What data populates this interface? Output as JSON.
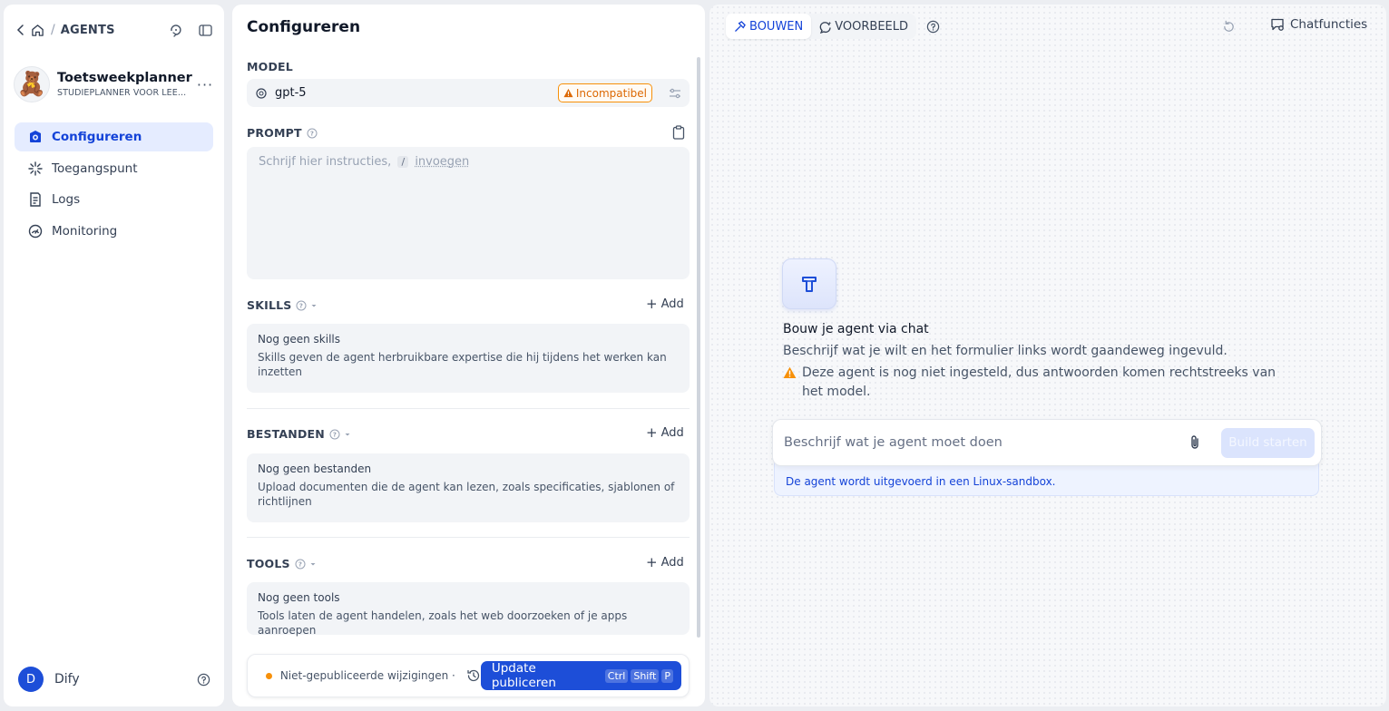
{
  "sidebar": {
    "breadcrumb": "AGENTS",
    "agent": {
      "name": "Toetsweekplanner",
      "subtitle": "STUDIEPLANNER VOOR LEE...",
      "more": "···"
    },
    "nav": [
      {
        "label": "Configureren",
        "icon": "configure-icon",
        "active": true
      },
      {
        "label": "Toegangspunt",
        "icon": "access-point-icon",
        "active": false
      },
      {
        "label": "Logs",
        "icon": "logs-icon",
        "active": false
      },
      {
        "label": "Monitoring",
        "icon": "monitoring-icon",
        "active": false
      }
    ],
    "user": {
      "initial": "D",
      "name": "Dify"
    }
  },
  "config": {
    "title": "Configureren",
    "model": {
      "label": "MODEL",
      "name": "gpt-5",
      "badge": "Incompatibel"
    },
    "prompt": {
      "label": "PROMPT",
      "placeholder_prefix": "Schrijf hier instructies,",
      "placeholder_key": "/",
      "placeholder_link": "invoegen"
    },
    "skills": {
      "label": "SKILLS",
      "add": "Add",
      "empty_title": "Nog geen skills",
      "empty_desc": "Skills geven de agent herbruikbare expertise die hij tijdens het werken kan inzetten"
    },
    "files": {
      "label": "BESTANDEN",
      "add": "Add",
      "empty_title": "Nog geen bestanden",
      "empty_desc": "Upload documenten die de agent kan lezen, zoals specificaties, sjablonen of richtlijnen"
    },
    "tools": {
      "label": "TOOLS",
      "add": "Add",
      "empty_title": "Nog geen tools",
      "empty_desc": "Tools laten de agent handelen, zoals het web doorzoeken of je apps aanroepen"
    },
    "publish": {
      "status": "Niet-gepubliceerde wijzigingen ·",
      "button": "Update publiceren",
      "keys": [
        "Ctrl",
        "Shift",
        "P"
      ]
    }
  },
  "builder": {
    "tabs": [
      {
        "label": "BOUWEN",
        "active": true
      },
      {
        "label": "VOORBEELD",
        "active": false
      }
    ],
    "chat_functions": "Chatfuncties",
    "hero": {
      "title": "Bouw je agent via chat",
      "description": "Beschrijf wat je wilt en het formulier links wordt gaandeweg ingevuld.",
      "warning": "Deze agent is nog niet ingesteld, dus antwoorden komen rechtstreeks van het model."
    },
    "input": {
      "placeholder": "Beschrijf wat je agent moet doen",
      "button": "Build starten"
    },
    "sandbox_note": "De agent wordt uitgevoerd in een Linux-sandbox."
  },
  "colors": {
    "accent": "#1d4ed8",
    "accent_text": "#1443d8",
    "warning": "#f79009",
    "nav_active_bg": "#e5ecff"
  }
}
